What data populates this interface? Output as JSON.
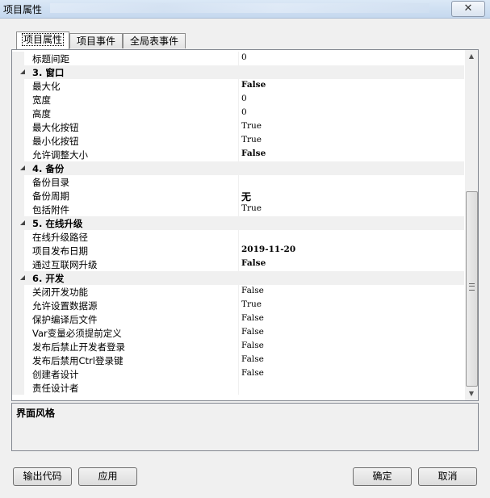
{
  "window": {
    "title": "项目属性"
  },
  "tabs": [
    {
      "label": "项目属性",
      "active": true
    },
    {
      "label": "项目事件",
      "active": false
    },
    {
      "label": "全局表事件",
      "active": false
    }
  ],
  "properties": [
    {
      "type": "prop",
      "name": "标题间距",
      "value": "0",
      "bold": false
    },
    {
      "type": "cat",
      "name": "3. 窗口"
    },
    {
      "type": "prop",
      "name": "最大化",
      "value": "False",
      "bold": true
    },
    {
      "type": "prop",
      "name": "宽度",
      "value": "0",
      "bold": false
    },
    {
      "type": "prop",
      "name": "高度",
      "value": "0",
      "bold": false
    },
    {
      "type": "prop",
      "name": "最大化按钮",
      "value": "True",
      "bold": false
    },
    {
      "type": "prop",
      "name": "最小化按钮",
      "value": "True",
      "bold": false
    },
    {
      "type": "prop",
      "name": "允许调整大小",
      "value": "False",
      "bold": true
    },
    {
      "type": "cat",
      "name": "4. 备份"
    },
    {
      "type": "prop",
      "name": "备份目录",
      "value": "",
      "bold": false
    },
    {
      "type": "prop",
      "name": "备份周期",
      "value": "无",
      "bold": true
    },
    {
      "type": "prop",
      "name": "包括附件",
      "value": "True",
      "bold": false
    },
    {
      "type": "cat",
      "name": "5. 在线升级"
    },
    {
      "type": "prop",
      "name": "在线升级路径",
      "value": "",
      "bold": false
    },
    {
      "type": "prop",
      "name": "项目发布日期",
      "value": "2019-11-20",
      "bold": true
    },
    {
      "type": "prop",
      "name": "通过互联网升级",
      "value": "False",
      "bold": true
    },
    {
      "type": "cat",
      "name": "6. 开发"
    },
    {
      "type": "prop",
      "name": "关闭开发功能",
      "value": "False",
      "bold": false
    },
    {
      "type": "prop",
      "name": "允许设置数据源",
      "value": "True",
      "bold": false
    },
    {
      "type": "prop",
      "name": "保护编译后文件",
      "value": "False",
      "bold": false
    },
    {
      "type": "prop",
      "name": "Var变量必须提前定义",
      "value": "False",
      "bold": false
    },
    {
      "type": "prop",
      "name": "发布后禁止开发者登录",
      "value": "False",
      "bold": false
    },
    {
      "type": "prop",
      "name": "发布后禁用Ctrl登录键",
      "value": "False",
      "bold": false
    },
    {
      "type": "prop",
      "name": "创建者设计",
      "value": "False",
      "bold": false
    },
    {
      "type": "prop",
      "name": "责任设计者",
      "value": "",
      "bold": false
    }
  ],
  "description": {
    "title": "界面风格"
  },
  "buttons": {
    "export_code": "输出代码",
    "apply": "应用",
    "ok": "确定",
    "cancel": "取消"
  },
  "icons": {
    "close": "close-icon",
    "scroll_up": "arrow-up-icon",
    "scroll_down": "arrow-down-icon"
  }
}
